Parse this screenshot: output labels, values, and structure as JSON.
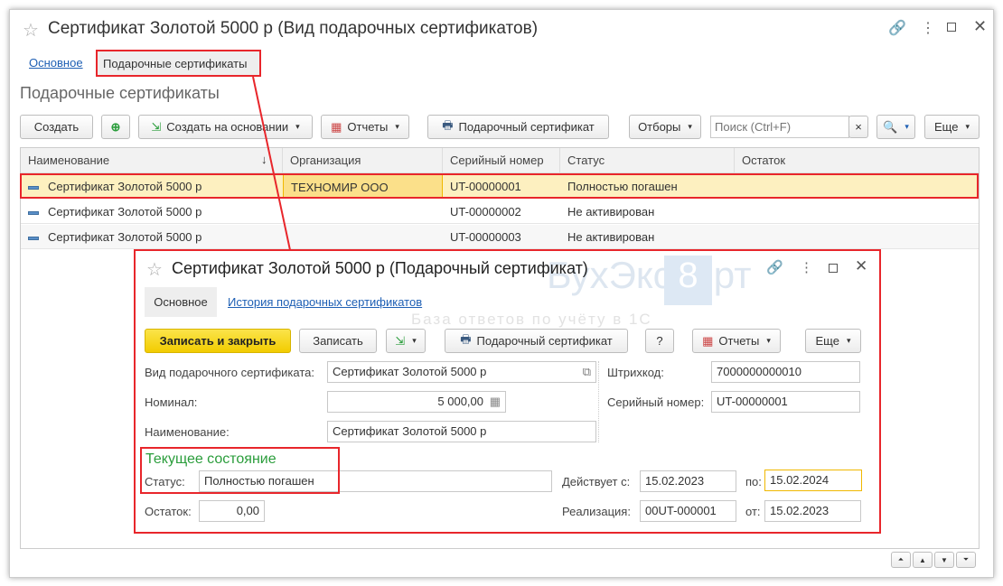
{
  "window": {
    "title": "Сертификат Золотой 5000 р (Вид подарочных сертификатов)",
    "tabs": [
      "Основное",
      "Подарочные сертификаты"
    ],
    "heading": "Подарочные сертификаты"
  },
  "toolbar": {
    "create": "Создать",
    "create_based": "Создать на основании",
    "reports": "Отчеты",
    "gift_cert": "Подарочный сертификат",
    "filters": "Отборы",
    "search_placeholder": "Поиск (Ctrl+F)",
    "search_clear": "×",
    "more": "Еще"
  },
  "table": {
    "columns": [
      "Наименование",
      "Организация",
      "Серийный номер",
      "Статус",
      "Остаток"
    ],
    "rows": [
      {
        "name": "Сертификат Золотой 5000 р",
        "org": "ТЕХНОМИР ООО",
        "serial": "UT-00000001",
        "status": "Полностью погашен",
        "rest": ""
      },
      {
        "name": "Сертификат Золотой 5000 р",
        "org": "",
        "serial": "UT-00000002",
        "status": "Не активирован",
        "rest": ""
      },
      {
        "name": "Сертификат Золотой 5000 р",
        "org": "",
        "serial": "UT-00000003",
        "status": "Не активирован",
        "rest": ""
      }
    ]
  },
  "dialog": {
    "title": "Сертификат Золотой 5000 р (Подарочный сертификат)",
    "tabs": [
      "Основное",
      "История подарочных сертификатов"
    ],
    "buttons": {
      "save_close": "Записать и закрыть",
      "save": "Записать",
      "gift_cert": "Подарочный сертификат",
      "help": "?",
      "reports": "Отчеты",
      "more": "Еще"
    },
    "fields": {
      "kind_label": "Вид подарочного сертификата:",
      "kind": "Сертификат Золотой 5000 р",
      "nominal_label": "Номинал:",
      "nominal": "5 000,00",
      "name_label": "Наименование:",
      "name": "Сертификат Золотой 5000 р",
      "barcode_label": "Штрихкод:",
      "barcode": "7000000000010",
      "serial_label": "Серийный номер:",
      "serial": "UT-00000001"
    },
    "state": {
      "heading": "Текущее состояние",
      "status_label": "Статус:",
      "status": "Полностью погашен",
      "rest_label": "Остаток:",
      "rest": "0,00",
      "valid_from_label": "Действует с:",
      "valid_from": "15.02.2023",
      "valid_to_label": "по:",
      "valid_to": "15.02.2024",
      "sale_label": "Реализация:",
      "sale": "00UT-000001",
      "sale_date_label": "от:",
      "sale_date": "15.02.2023"
    }
  },
  "watermark": {
    "brand": "БухЭксперт 8",
    "tagline": "База ответов по учёту в 1С"
  },
  "colors": {
    "highlight": "#e8262b",
    "accent_yellow": "#f5d81a",
    "selected_row": "#fdf0c0",
    "link": "#1e5fb4",
    "green": "#2a9d3b"
  }
}
